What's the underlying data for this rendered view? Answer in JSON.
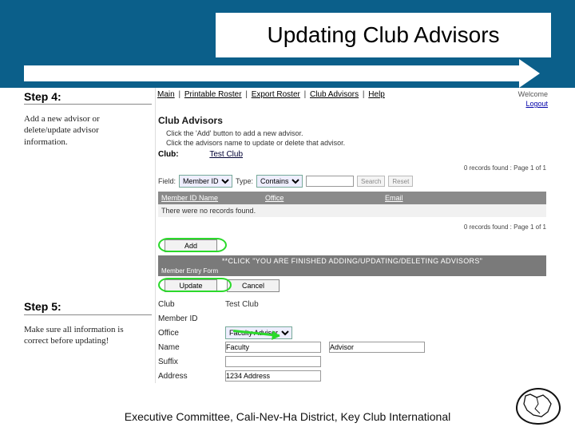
{
  "title": "Updating Club Advisors",
  "footer": "Executive Committee, Cali-Nev-Ha District, Key Club International",
  "nav": {
    "items": [
      "Main",
      "Printable Roster",
      "Export Roster",
      "Club Advisors",
      "Help"
    ],
    "welcome": "Welcome",
    "logout": "Logout"
  },
  "step4": {
    "label": "Step 4:",
    "desc": "Add a new advisor or delete/update advisor information."
  },
  "step5": {
    "label": "Step 5:",
    "desc": "Make sure all information is correct before updating!"
  },
  "advisors": {
    "section_title": "Club Advisors",
    "instr1": "Click the 'Add' button to add a new advisor.",
    "instr2": "Click the advisors name to update or delete that advisor.",
    "club_label": "Club:",
    "club_value": "Test Club",
    "pager": "0 records found  :  Page 1 of 1",
    "filter": {
      "field_label": "Field:",
      "field_value": "Member ID",
      "type_label": "Type:",
      "type_value": "Contains",
      "search_btn": "Search",
      "reset_btn": "Reset"
    },
    "grid": {
      "col1": "Member ID Name",
      "col2": "Office",
      "col3": "Email",
      "empty": "There were no records found."
    },
    "add_btn": "Add",
    "click_banner": "**CLICK \"YOU ARE FINISHED ADDING/UPDATING/DELETING ADVISORS\"",
    "form_head": "Member Entry Form",
    "update_btn": "Update",
    "cancel_btn": "Cancel"
  },
  "form": {
    "rows": {
      "club": {
        "label": "Club",
        "value": "Test Club"
      },
      "member_id": {
        "label": "Member ID",
        "value": ""
      },
      "office": {
        "label": "Office",
        "value": "Faculty Advisor"
      },
      "name": {
        "label": "Name",
        "first": "Faculty",
        "last": "Advisor"
      },
      "suffix": {
        "label": "Suffix",
        "value": ""
      },
      "address": {
        "label": "Address",
        "value": "1234 Address"
      }
    }
  }
}
